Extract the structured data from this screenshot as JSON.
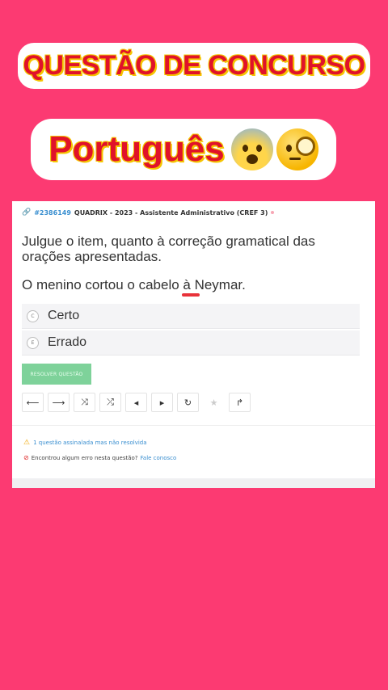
{
  "banner_top": {
    "text": "QUESTÃO DE CONCURSO"
  },
  "banner_subject": {
    "text": "Português",
    "emojis": [
      "fearful-face-emoji",
      "face-with-monocle-emoji"
    ]
  },
  "question": {
    "id": "#2386149",
    "meta": "QUADRIX - 2023 - Assistente Administrativo (CREF 3)",
    "prompt": "Julgue o item, quanto à correção gramatical das orações apresentadas.",
    "statement": "O menino cortou o cabelo à Neymar.",
    "options": [
      {
        "letter": "C",
        "label": "Certo"
      },
      {
        "letter": "E",
        "label": "Errado"
      }
    ],
    "resolve_button": "RESOLVER QUESTÃO"
  },
  "toolbar": {
    "icons": [
      "arrow-left-icon",
      "arrow-right-icon",
      "shuffle-icon",
      "shuffle-alt-icon",
      "prev-icon",
      "next-icon",
      "reload-icon",
      "star-icon",
      "corner-arrow-icon"
    ],
    "glyphs": [
      "⟵",
      "⟶",
      "⤨",
      "⤮",
      "◂",
      "▸",
      "↻",
      "★",
      "↱"
    ]
  },
  "notes": {
    "pending": "1 questão assinalada mas não resolvida",
    "error_prompt": "Encontrou algum erro nesta questão?",
    "contact": "Fale conosco"
  },
  "colors": {
    "background": "#fc3a72",
    "title_red": "#e0122a",
    "title_outline": "#f5c400",
    "link_blue": "#3a8fd0",
    "resolve_green": "#7ed29a"
  }
}
